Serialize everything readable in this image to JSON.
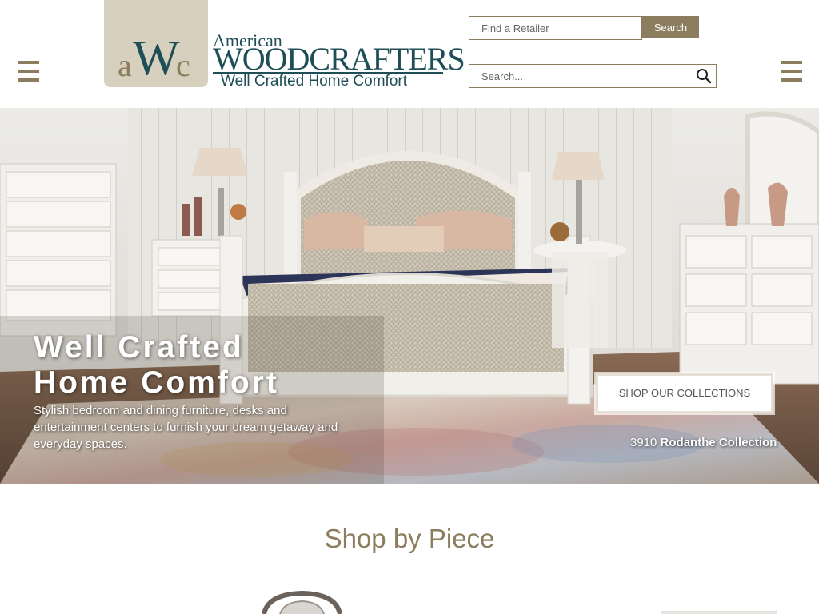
{
  "brand": {
    "monogram": "aWc",
    "name_top": "American",
    "name_main": "WOODCRAFTERS",
    "tagline": "Well Crafted Home Comfort"
  },
  "header": {
    "retailer_placeholder": "Find a Retailer",
    "retailer_button": "Search",
    "search_placeholder": "Search..."
  },
  "hero": {
    "title_line1": "Well Crafted",
    "title_line2": "Home Comfort",
    "subtitle": "Stylish bedroom and dining furniture, desks and entertainment centers to furnish your dream getaway and everyday spaces.",
    "cta_label": "SHOP OUR COLLECTIONS",
    "collection_number": "3910",
    "collection_name": "Rodanthe Collection"
  },
  "sections": {
    "shop_by_piece": "Shop by Piece"
  },
  "colors": {
    "accent": "#8b7d5d",
    "brand_teal": "#1f4e57",
    "logo_bg": "#d8d0bf"
  },
  "icons": {
    "menu": "hamburger-menu-icon",
    "search": "magnifier-search-icon"
  }
}
